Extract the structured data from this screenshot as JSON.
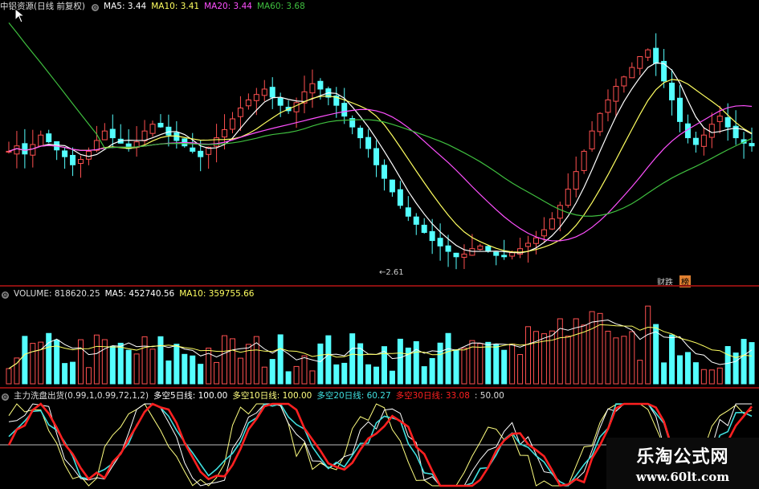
{
  "price_header": {
    "title": "中铝资源(日线 前复权)",
    "ma5": "MA5: 3.44",
    "ma10": "MA10: 3.41",
    "ma20": "MA20: 3.44",
    "ma60": "MA60: 3.68"
  },
  "price_annotation": "←2.61",
  "price_tags": [
    "财跌",
    "榜"
  ],
  "volume_header": {
    "title": "VOLUME: 818620.25",
    "ma5": "MA5: 452740.56",
    "ma10": "MA10: 359755.66"
  },
  "osc_header": {
    "title": "主力洗盘出货(0.99,1,0.99,72,1,2)",
    "l5": "多空5日线: 100.00",
    "l10": "多空10日线: 100.00",
    "l20": "多空20日线: 60.27",
    "l30": "多空30日线: 33.08",
    "level": ": 50.00"
  },
  "watermark": {
    "name": "乐淘公式网",
    "url": "www.60lt.com"
  },
  "colors": {
    "up": "#ff5050",
    "down": "#54ffff",
    "ma5": "#ffffff",
    "ma10": "#ffff60",
    "ma20": "#ff50ff",
    "ma60": "#3fbf3f",
    "sep": "#8a1010",
    "osc_red": "#ff2020",
    "osc_cyan": "#40e0e0",
    "osc_white": "#ffffff",
    "osc_yellow": "#ffff80"
  },
  "chart_data": [
    {
      "type": "candlestick",
      "title": "中铝资源(日线 前复权)",
      "series": [
        {
          "name": "MA5",
          "value": 3.44
        },
        {
          "name": "MA10",
          "value": 3.41
        },
        {
          "name": "MA20",
          "value": 3.44
        },
        {
          "name": "MA60",
          "value": 3.68
        }
      ],
      "annotations": [
        "←2.61"
      ],
      "close": [
        3.4,
        3.44,
        3.38,
        3.45,
        3.52,
        3.47,
        3.41,
        3.36,
        3.3,
        3.34,
        3.4,
        3.48,
        3.55,
        3.5,
        3.46,
        3.42,
        3.47,
        3.55,
        3.6,
        3.58,
        3.52,
        3.48,
        3.44,
        3.4,
        3.36,
        3.43,
        3.5,
        3.56,
        3.64,
        3.72,
        3.78,
        3.82,
        3.86,
        3.8,
        3.74,
        3.7,
        3.76,
        3.84,
        3.9,
        3.86,
        3.8,
        3.74,
        3.66,
        3.58,
        3.5,
        3.42,
        3.3,
        3.2,
        3.1,
        3.0,
        2.92,
        2.86,
        2.8,
        2.74,
        2.7,
        2.66,
        2.62,
        2.64,
        2.68,
        2.7,
        2.66,
        2.63,
        2.62,
        2.65,
        2.68,
        2.72,
        2.76,
        2.82,
        2.9,
        3.0,
        3.12,
        3.25,
        3.4,
        3.55,
        3.68,
        3.78,
        3.88,
        3.95,
        4.02,
        4.1,
        4.15,
        4.05,
        3.92,
        3.78,
        3.62,
        3.5,
        3.45,
        3.52,
        3.6,
        3.66,
        3.58,
        3.5,
        3.46,
        3.44
      ],
      "volume_header": {
        "VOLUME": 818620.25,
        "MA5": 452740.56,
        "MA10": 359755.66
      },
      "oscillator": {
        "name": "主力洗盘出货",
        "params": "(0.99,1,0.99,72,1,2)",
        "多空5日线": 100.0,
        "多空10日线": 100.0,
        "多空20日线": 60.27,
        "多空30日线": 33.08,
        "level": 50.0
      }
    }
  ]
}
